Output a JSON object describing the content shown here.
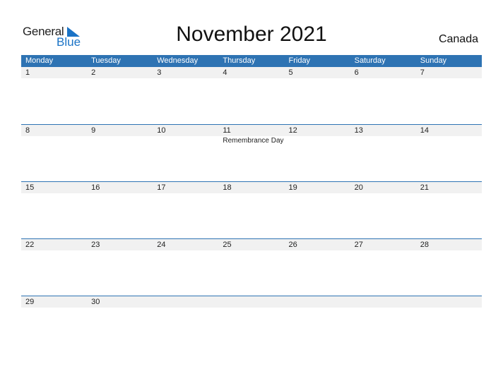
{
  "logo": {
    "general": "General",
    "blue": "Blue"
  },
  "title": "November 2021",
  "country": "Canada",
  "colors": {
    "header": "#2e73b3",
    "band": "#f1f1f1",
    "logo_blue": "#1a73c6"
  },
  "weekdays": [
    "Monday",
    "Tuesday",
    "Wednesday",
    "Thursday",
    "Friday",
    "Saturday",
    "Sunday"
  ],
  "weeks": [
    {
      "days": [
        "1",
        "2",
        "3",
        "4",
        "5",
        "6",
        "7"
      ],
      "events": [
        "",
        "",
        "",
        "",
        "",
        "",
        ""
      ]
    },
    {
      "days": [
        "8",
        "9",
        "10",
        "11",
        "12",
        "13",
        "14"
      ],
      "events": [
        "",
        "",
        "",
        "Remembrance Day",
        "",
        "",
        ""
      ]
    },
    {
      "days": [
        "15",
        "16",
        "17",
        "18",
        "19",
        "20",
        "21"
      ],
      "events": [
        "",
        "",
        "",
        "",
        "",
        "",
        ""
      ]
    },
    {
      "days": [
        "22",
        "23",
        "24",
        "25",
        "26",
        "27",
        "28"
      ],
      "events": [
        "",
        "",
        "",
        "",
        "",
        "",
        ""
      ]
    },
    {
      "days": [
        "29",
        "30",
        "",
        "",
        "",
        "",
        ""
      ],
      "events": [
        "",
        "",
        "",
        "",
        "",
        "",
        ""
      ]
    }
  ]
}
